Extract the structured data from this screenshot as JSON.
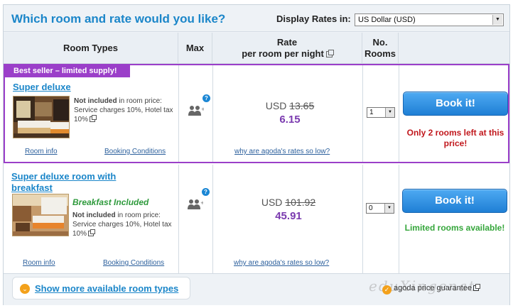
{
  "header": {
    "title": "Which room and rate would you like?",
    "display_rates_label": "Display Rates in:",
    "currency_value": "US Dollar (USD)"
  },
  "columns": {
    "room_types": "Room Types",
    "max": "Max",
    "rate_line1": "Rate",
    "rate_line2": "per room per night",
    "rooms_line1": "No.",
    "rooms_line2": "Rooms"
  },
  "rooms": [
    {
      "badge": "Best seller – limited supply!",
      "name": "Super deluxe",
      "name_line2": "",
      "breakfast": "",
      "not_included_label": "Not included",
      "note_rest": " in room price: Service charges 10%, Hotel tax 10%",
      "room_info": "Room info",
      "booking_conditions": "Booking Conditions",
      "currency": "USD",
      "old_price": "13.65",
      "new_price": "6.15",
      "why_link": "why are agoda's rates so low?",
      "quantity": "1",
      "book_label": "Book it!",
      "availability": "Only 2 rooms left at this price!",
      "availability_color": "#c1171c"
    },
    {
      "badge": "",
      "name": "Super deluxe room with",
      "name_line2": "breakfast",
      "breakfast": "Breakfast Included",
      "not_included_label": "Not included",
      "note_rest": " in room price: Service charges 10%, Hotel tax 10%",
      "room_info": "Room info",
      "booking_conditions": "Booking Conditions",
      "currency": "USD",
      "old_price": "101.92",
      "new_price": "45.91",
      "why_link": "why are agoda's rates so low?",
      "quantity": "0",
      "book_label": "Book it!",
      "availability": "Limited rooms available!",
      "availability_color": "#35a63b"
    }
  ],
  "icons": {
    "help": "?",
    "dropdown": "▼",
    "chevron": "⌄",
    "check": "✓"
  },
  "footer": {
    "show_more": "Show more available room types",
    "guarantee": "agoda price guarantee",
    "watermark": "eduXingenat"
  }
}
